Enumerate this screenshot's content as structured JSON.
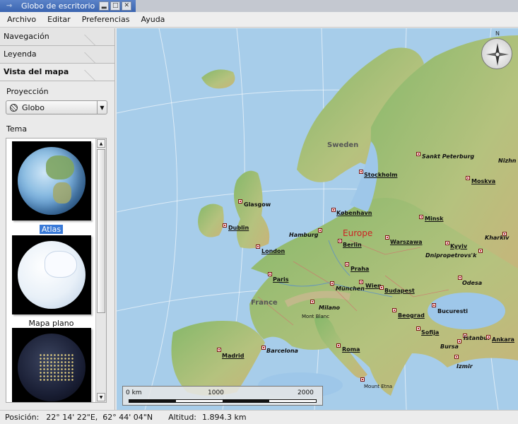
{
  "window": {
    "title": "Globo de escritorio"
  },
  "menu": {
    "items": [
      "Archivo",
      "Editar",
      "Preferencias",
      "Ayuda"
    ]
  },
  "sidebar": {
    "sections": [
      "Navegación",
      "Leyenda",
      "Vista del mapa"
    ],
    "projection_label": "Proyección",
    "projection_value": "Globo",
    "theme_label": "Tema",
    "themes": [
      "Atlas",
      "Mapa plano",
      ""
    ]
  },
  "map": {
    "continent": "Europe",
    "regions": [
      "Sweden",
      "France"
    ],
    "cities": [
      {
        "name": "Sankt Peterburg",
        "style": "it"
      },
      {
        "name": "Stockholm",
        "style": "cap"
      },
      {
        "name": "Moskva",
        "style": "cap"
      },
      {
        "name": "Glasgow",
        "style": "plain"
      },
      {
        "name": "København",
        "style": "cap"
      },
      {
        "name": "Minsk",
        "style": "cap"
      },
      {
        "name": "Dublin",
        "style": "cap"
      },
      {
        "name": "Hamburg",
        "style": "it"
      },
      {
        "name": "Warszawa",
        "style": "cap"
      },
      {
        "name": "London",
        "style": "cap"
      },
      {
        "name": "Berlin",
        "style": "cap"
      },
      {
        "name": "Kyyiv",
        "style": "cap"
      },
      {
        "name": "Kharkiv",
        "style": "it"
      },
      {
        "name": "Dnipropetrovs'k",
        "style": "it"
      },
      {
        "name": "Praha",
        "style": "cap"
      },
      {
        "name": "Paris",
        "style": "cap"
      },
      {
        "name": "Odesa",
        "style": "it"
      },
      {
        "name": "München",
        "style": "it"
      },
      {
        "name": "Wien",
        "style": "cap"
      },
      {
        "name": "Budapest",
        "style": "cap"
      },
      {
        "name": "Milano",
        "style": "it"
      },
      {
        "name": "Bucuresti",
        "style": "plain"
      },
      {
        "name": "Beograd",
        "style": "cap"
      },
      {
        "name": "Mont Blanc",
        "style": "small"
      },
      {
        "name": "Sofija",
        "style": "cap"
      },
      {
        "name": "Istanbul",
        "style": "it"
      },
      {
        "name": "Ankara",
        "style": "cap"
      },
      {
        "name": "Barcelona",
        "style": "it"
      },
      {
        "name": "Roma",
        "style": "cap"
      },
      {
        "name": "Bursa",
        "style": "it"
      },
      {
        "name": "Madrid",
        "style": "cap"
      },
      {
        "name": "Izmir",
        "style": "it"
      },
      {
        "name": "Nizhn",
        "style": "it"
      },
      {
        "name": "Mount Etna",
        "style": "small"
      }
    ],
    "compass_north": "N",
    "scale": {
      "labels": [
        "0 km",
        "1000",
        "2000"
      ]
    }
  },
  "status": {
    "position_label": "Posición:",
    "position_value": "22° 14' 22\"E,  62° 44' 04\"N",
    "altitude_label": "Altitud:",
    "altitude_value": "1.894.3 km"
  }
}
